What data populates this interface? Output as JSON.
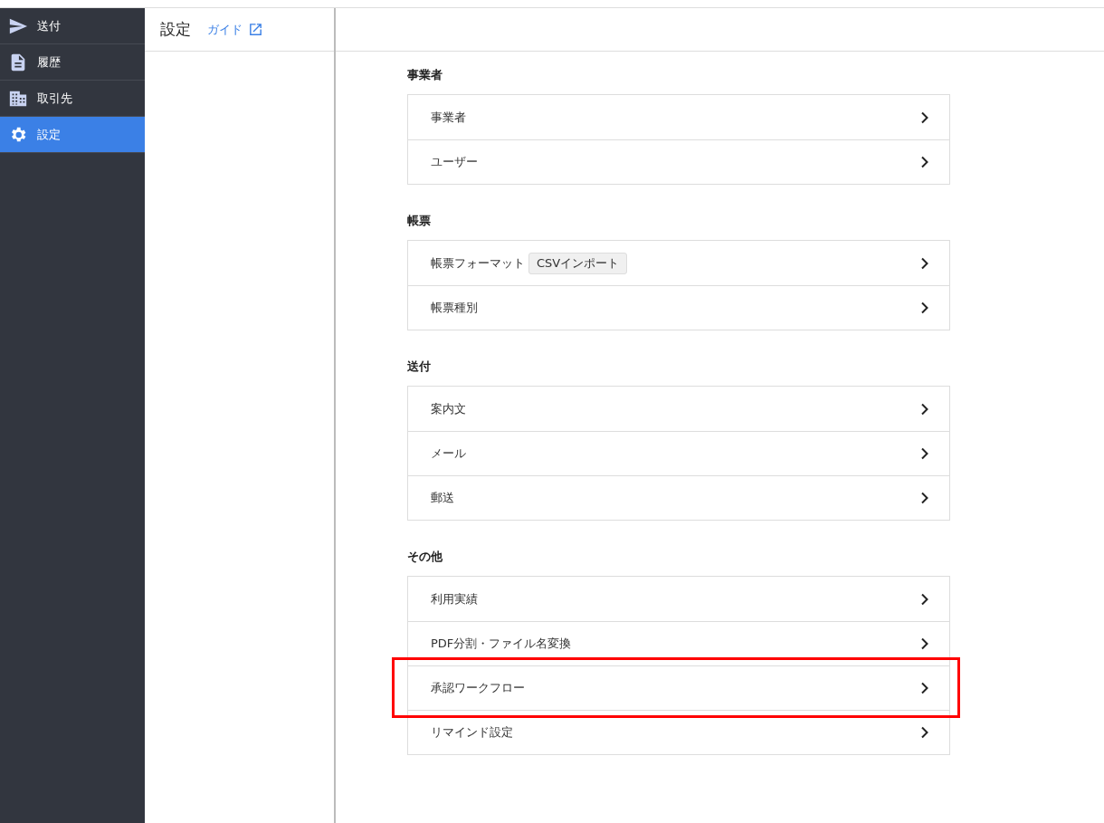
{
  "sidebar": {
    "items": [
      {
        "label": "送付",
        "kind": "send",
        "selected": false
      },
      {
        "label": "履歴",
        "kind": "document",
        "selected": false
      },
      {
        "label": "取引先",
        "kind": "building",
        "selected": false
      },
      {
        "label": "設定",
        "kind": "gear",
        "selected": true
      }
    ]
  },
  "header": {
    "title": "設定",
    "guide_link": "ガイド"
  },
  "sections": [
    {
      "title": "事業者",
      "items": [
        {
          "label": "事業者",
          "highlighted": false
        },
        {
          "label": "ユーザー",
          "highlighted": false
        }
      ]
    },
    {
      "title": "帳票",
      "items": [
        {
          "label": "帳票フォーマット",
          "tag": "CSVインポート",
          "highlighted": false
        },
        {
          "label": "帳票種別",
          "highlighted": false
        }
      ]
    },
    {
      "title": "送付",
      "items": [
        {
          "label": "案内文",
          "highlighted": false
        },
        {
          "label": "メール",
          "highlighted": false
        },
        {
          "label": "郵送",
          "highlighted": false
        }
      ]
    },
    {
      "title": "その他",
      "items": [
        {
          "label": "利用実績",
          "highlighted": false
        },
        {
          "label": "PDF分割・ファイル名変換",
          "highlighted": false
        },
        {
          "label": "承認ワークフロー",
          "highlighted": true
        },
        {
          "label": "リマインド設定",
          "highlighted": false
        }
      ]
    }
  ]
}
